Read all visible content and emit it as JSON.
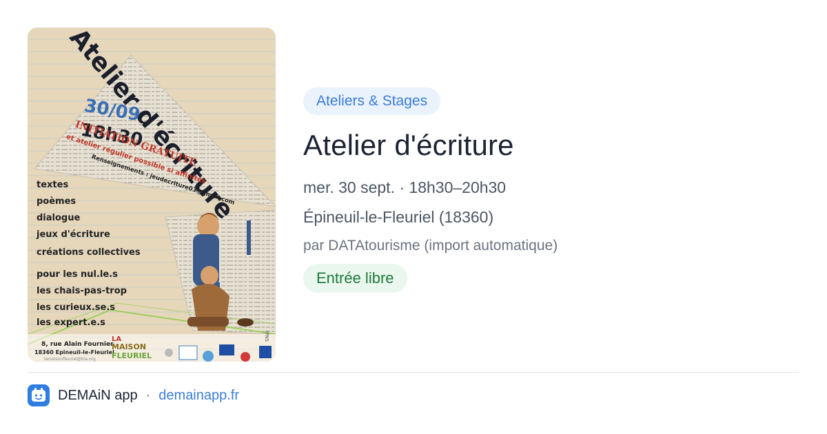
{
  "event": {
    "category": "Ateliers & Stages",
    "title": "Atelier d'écriture",
    "datetime": "mer. 30 sept. · 18h30–20h30",
    "location": "Épineuil-le-Fleuriel (18360)",
    "source": "par DATAtourisme (import automatique)",
    "price": "Entrée libre"
  },
  "poster": {
    "heading": "Atelier d'écriture",
    "date": "30/09",
    "time": "18h30",
    "initiation": "INITIATION GRATUITE",
    "subline": "et atelier régulier possible si affinités",
    "contact": "Renseignements : jeudecriture03@gmail.com",
    "items": [
      "textes",
      "poèmes",
      "dialogue",
      "jeux d'écriture",
      "créations collectives"
    ],
    "audience": [
      "pour les nul.le.s",
      "les chais-pas-trop",
      "les curieux.se.s",
      "les expert.e.s"
    ],
    "address_1": "8, rue Alain Fournier",
    "address_2": "18360 Epineuil-le-Fleuriel",
    "website": "lamaisonfleuriel@bla.org",
    "logo_text_1": "LA",
    "logo_text_2": "MAISON",
    "logo_text_3": "FLEURIEL",
    "credit": "IPNS"
  },
  "footer": {
    "app_name": "DEMAiN app",
    "separator": "·",
    "domain": "demainapp.fr"
  },
  "colors": {
    "category_bg": "#eaf2fc",
    "category_text": "#3b7dd8",
    "price_bg": "#eaf7ee",
    "price_text": "#1e7a3c",
    "link": "#3b7dd8"
  }
}
